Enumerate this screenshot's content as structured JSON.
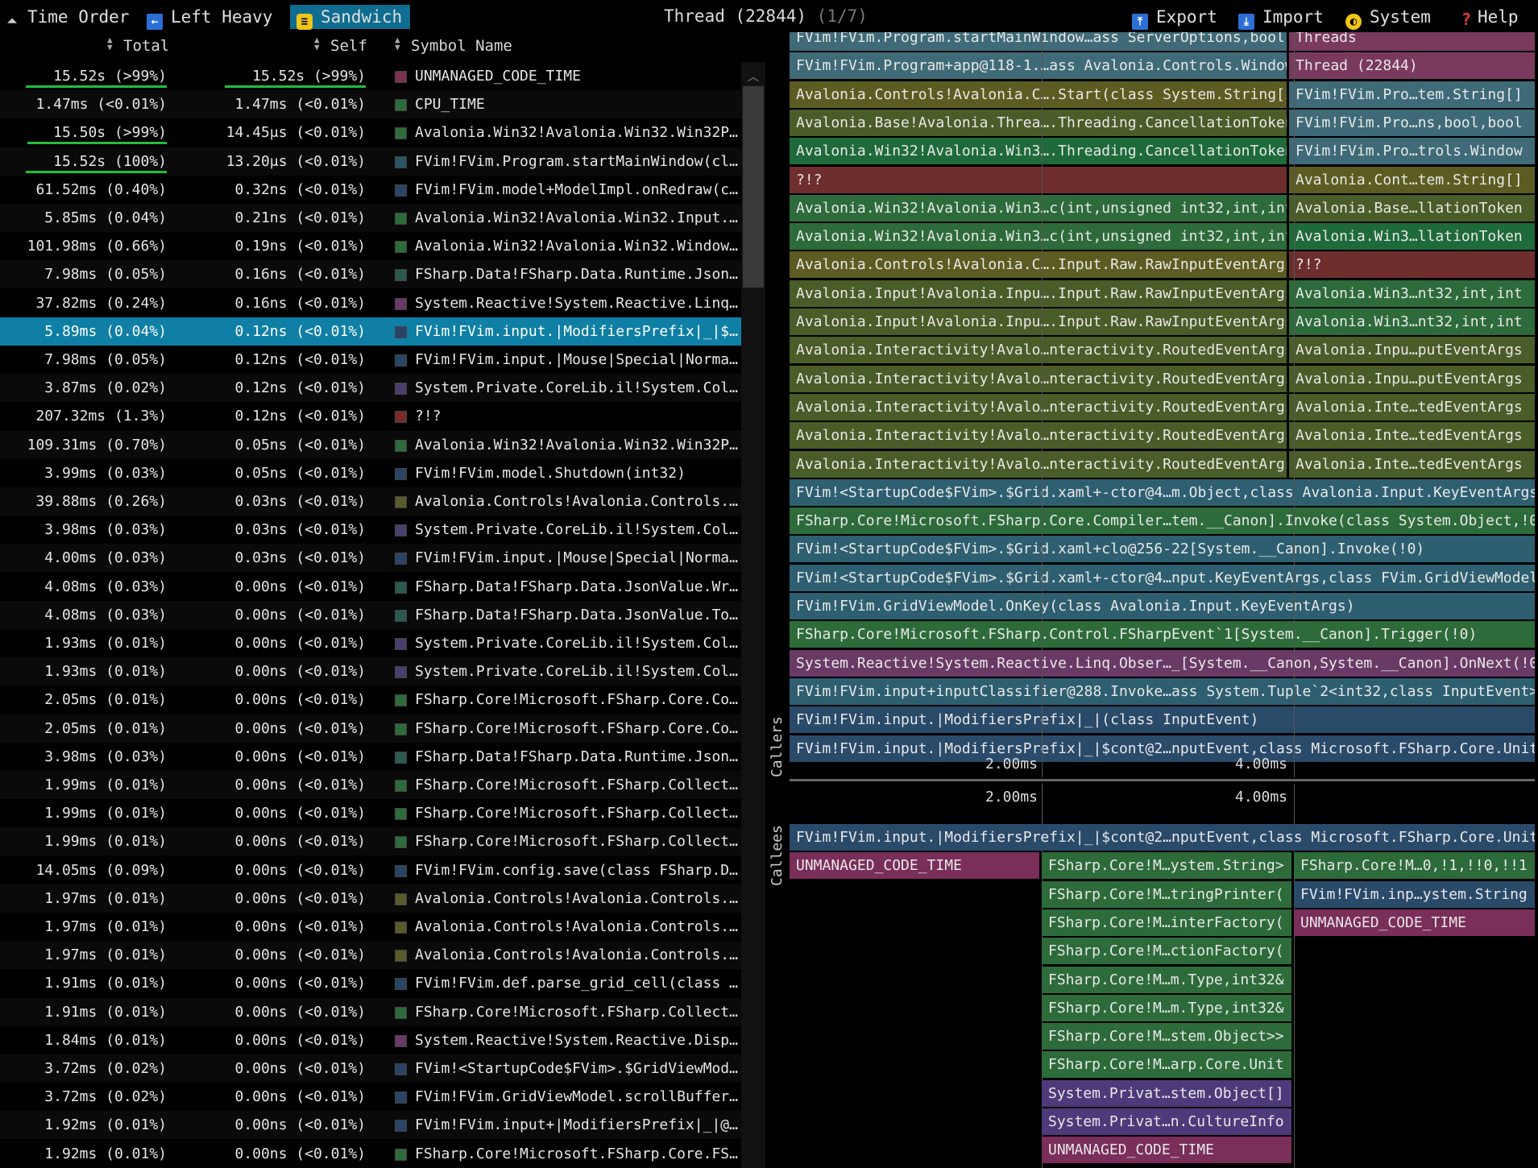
{
  "toolbar": {
    "time_order": "Time Order",
    "left_heavy": "Left Heavy",
    "sandwich": "Sandwich",
    "thread_title": "Thread (22844)",
    "thread_index": "(1/7)",
    "export": "Export",
    "import": "Import",
    "system": "System",
    "help": "Help"
  },
  "table": {
    "headers": {
      "total": "Total",
      "self": "Self",
      "symbol": "Symbol Name"
    },
    "rows": [
      {
        "total": "15.52s (>99%)",
        "self": "15.52s (>99%)",
        "name": "UNMANAGED_CODE_TIME",
        "color": "#7a3050",
        "tbar": 1.0,
        "sbar": 1.0
      },
      {
        "total": "1.47ms (<0.01%)",
        "self": "1.47ms (<0.01%)",
        "name": "CPU_TIME",
        "color": "#2d6b3a",
        "tbar": 0,
        "sbar": 0
      },
      {
        "total": "15.50s (>99%)",
        "self": "14.45μs (<0.01%)",
        "name": "Avalonia.Win32!Avalonia.Win32.Win32Pl…",
        "color": "#2d6b3a",
        "tbar": 0.99,
        "sbar": 0
      },
      {
        "total": "15.52s (100%)",
        "self": "13.20μs (<0.01%)",
        "name": "FVim!FVim.Program.startMainWindow(cla…",
        "color": "#2a5566",
        "tbar": 1.0,
        "sbar": 0
      },
      {
        "total": "61.52ms (0.40%)",
        "self": "0.32ns (<0.01%)",
        "name": "FVim!FVim.model+ModelImpl.onRedraw(cl…",
        "color": "#2a4466",
        "tbar": 0,
        "sbar": 0
      },
      {
        "total": "5.85ms (0.04%)",
        "self": "0.21ns (<0.01%)",
        "name": "Avalonia.Win32!Avalonia.Win32.Input.K…",
        "color": "#2d6b3a",
        "tbar": 0,
        "sbar": 0
      },
      {
        "total": "101.98ms (0.66%)",
        "self": "0.19ns (<0.01%)",
        "name": "Avalonia.Win32!Avalonia.Win32.WindowI…",
        "color": "#2d6b3a",
        "tbar": 0,
        "sbar": 0
      },
      {
        "total": "7.98ms (0.05%)",
        "self": "0.16ns (<0.01%)",
        "name": "FSharp.Data!FSharp.Data.Runtime.JsonR…",
        "color": "#2a5a4e",
        "tbar": 0,
        "sbar": 0
      },
      {
        "total": "37.82ms (0.24%)",
        "self": "0.16ns (<0.01%)",
        "name": "System.Reactive!System.Reactive.Linq.…",
        "color": "#6a3a66",
        "tbar": 0,
        "sbar": 0
      },
      {
        "total": "5.89ms (0.04%)",
        "self": "0.12ns (<0.01%)",
        "name": "FVim!FVim.input.|ModifiersPrefix|_|$c…",
        "color": "#2a4466",
        "tbar": 0,
        "sbar": 0
      },
      {
        "total": "7.98ms (0.05%)",
        "self": "0.12ns (<0.01%)",
        "name": "FVim!FVim.input.|Mouse|Special|Normal…",
        "color": "#2a4466",
        "tbar": 0,
        "sbar": 0
      },
      {
        "total": "3.87ms (0.02%)",
        "self": "0.12ns (<0.01%)",
        "name": "System.Private.CoreLib.il!System.Coll…",
        "color": "#4a3e6e",
        "tbar": 0,
        "sbar": 0
      },
      {
        "total": "207.32ms (1.3%)",
        "self": "0.12ns (<0.01%)",
        "name": "?!?",
        "color": "#7a2a2a",
        "tbar": 0,
        "sbar": 0
      },
      {
        "total": "109.31ms (0.70%)",
        "self": "0.05ns (<0.01%)",
        "name": "Avalonia.Win32!Avalonia.Win32.Win32Pl…",
        "color": "#2d6b3a",
        "tbar": 0,
        "sbar": 0
      },
      {
        "total": "3.99ms (0.03%)",
        "self": "0.05ns (<0.01%)",
        "name": "FVim!FVim.model.Shutdown(int32)",
        "color": "#2a4466",
        "tbar": 0,
        "sbar": 0
      },
      {
        "total": "39.88ms (0.26%)",
        "self": "0.03ns (<0.01%)",
        "name": "Avalonia.Controls!Avalonia.Controls.T…",
        "color": "#5a5a2a",
        "tbar": 0,
        "sbar": 0
      },
      {
        "total": "3.98ms (0.03%)",
        "self": "0.03ns (<0.01%)",
        "name": "System.Private.CoreLib.il!System.Coll…",
        "color": "#4a3e6e",
        "tbar": 0,
        "sbar": 0
      },
      {
        "total": "4.00ms (0.03%)",
        "self": "0.03ns (<0.01%)",
        "name": "FVim!FVim.input.|Mouse|Special|Normal…",
        "color": "#2a4466",
        "tbar": 0,
        "sbar": 0
      },
      {
        "total": "4.08ms (0.03%)",
        "self": "0.00ns (<0.01%)",
        "name": "FSharp.Data!FSharp.Data.JsonValue.Wri…",
        "color": "#2a5a4e",
        "tbar": 0,
        "sbar": 0
      },
      {
        "total": "4.08ms (0.03%)",
        "self": "0.00ns (<0.01%)",
        "name": "FSharp.Data!FSharp.Data.JsonValue.ToS…",
        "color": "#2a5a4e",
        "tbar": 0,
        "sbar": 0
      },
      {
        "total": "1.93ms (0.01%)",
        "self": "0.00ns (<0.01%)",
        "name": "System.Private.CoreLib.il!System.Coll…",
        "color": "#4a3e6e",
        "tbar": 0,
        "sbar": 0
      },
      {
        "total": "1.93ms (0.01%)",
        "self": "0.00ns (<0.01%)",
        "name": "System.Private.CoreLib.il!System.Coll…",
        "color": "#4a3e6e",
        "tbar": 0,
        "sbar": 0
      },
      {
        "total": "2.05ms (0.01%)",
        "self": "0.00ns (<0.01%)",
        "name": "FSharp.Core!Microsoft.FSharp.Core.Com…",
        "color": "#2d6b3a",
        "tbar": 0,
        "sbar": 0
      },
      {
        "total": "2.05ms (0.01%)",
        "self": "0.00ns (<0.01%)",
        "name": "FSharp.Core!Microsoft.FSharp.Core.Com…",
        "color": "#2d6b3a",
        "tbar": 0,
        "sbar": 0
      },
      {
        "total": "3.98ms (0.03%)",
        "self": "0.00ns (<0.01%)",
        "name": "FSharp.Data!FSharp.Data.Runtime.JsonR…",
        "color": "#2a5a4e",
        "tbar": 0,
        "sbar": 0
      },
      {
        "total": "1.99ms (0.01%)",
        "self": "0.00ns (<0.01%)",
        "name": "FSharp.Core!Microsoft.FSharp.Collecti…",
        "color": "#2d6b3a",
        "tbar": 0,
        "sbar": 0
      },
      {
        "total": "1.99ms (0.01%)",
        "self": "0.00ns (<0.01%)",
        "name": "FSharp.Core!Microsoft.FSharp.Collecti…",
        "color": "#2d6b3a",
        "tbar": 0,
        "sbar": 0
      },
      {
        "total": "1.99ms (0.01%)",
        "self": "0.00ns (<0.01%)",
        "name": "FSharp.Core!Microsoft.FSharp.Collecti…",
        "color": "#2d6b3a",
        "tbar": 0,
        "sbar": 0
      },
      {
        "total": "14.05ms (0.09%)",
        "self": "0.00ns (<0.01%)",
        "name": "FVim!FVim.config.save(class FSharp.Da…",
        "color": "#2a4466",
        "tbar": 0,
        "sbar": 0
      },
      {
        "total": "1.97ms (0.01%)",
        "self": "0.00ns (<0.01%)",
        "name": "Avalonia.Controls!Avalonia.Controls.W…",
        "color": "#5a5a2a",
        "tbar": 0,
        "sbar": 0
      },
      {
        "total": "1.97ms (0.01%)",
        "self": "0.00ns (<0.01%)",
        "name": "Avalonia.Controls!Avalonia.Controls.W…",
        "color": "#5a5a2a",
        "tbar": 0,
        "sbar": 0
      },
      {
        "total": "1.97ms (0.01%)",
        "self": "0.00ns (<0.01%)",
        "name": "Avalonia.Controls!Avalonia.Controls.A…",
        "color": "#5a5a2a",
        "tbar": 0,
        "sbar": 0
      },
      {
        "total": "1.91ms (0.01%)",
        "self": "0.00ns (<0.01%)",
        "name": "FVim!FVim.def.parse_grid_cell(class S…",
        "color": "#2a4466",
        "tbar": 0,
        "sbar": 0
      },
      {
        "total": "1.91ms (0.01%)",
        "self": "0.00ns (<0.01%)",
        "name": "FSharp.Core!Microsoft.FSharp.Collecti…",
        "color": "#2d6b3a",
        "tbar": 0,
        "sbar": 0
      },
      {
        "total": "1.84ms (0.01%)",
        "self": "0.00ns (<0.01%)",
        "name": "System.Reactive!System.Reactive.Dispo…",
        "color": "#6a3a66",
        "tbar": 0,
        "sbar": 0
      },
      {
        "total": "3.72ms (0.02%)",
        "self": "0.00ns (<0.01%)",
        "name": "FVim!<StartupCode$FVim>.$GridViewMode…",
        "color": "#2a4466",
        "tbar": 0,
        "sbar": 0
      },
      {
        "total": "3.72ms (0.02%)",
        "self": "0.00ns (<0.01%)",
        "name": "FVim!FVim.GridViewModel.scrollBuffer(…",
        "color": "#2a4466",
        "tbar": 0,
        "sbar": 0
      },
      {
        "total": "1.92ms (0.01%)",
        "self": "0.00ns (<0.01%)",
        "name": "FVim!FVim.input+|ModifiersPrefix|_|@2…",
        "color": "#2a4466",
        "tbar": 0,
        "sbar": 0
      },
      {
        "total": "1.92ms (0.01%)",
        "self": "0.00ns (<0.01%)",
        "name": "FSharp.Core!Microsoft.FSharp.Core.FSh…",
        "color": "#2d6b3a",
        "tbar": 0,
        "sbar": 0
      }
    ],
    "selected_index": 9
  },
  "callers": {
    "label": "Callers",
    "ticks": [
      "2.00ms",
      "4.00ms"
    ],
    "frames": [
      {
        "text": "FVim!FVim.Program.startMainWindow…ass ServerOptions,bool,bool",
        "col": 0,
        "color": "#3f6b78"
      },
      {
        "text": "Threads",
        "col": 1,
        "color": "#7a3a5e"
      },
      {
        "text": "FVim!FVim.Program+app@118-1.…ass Avalonia.Controls.Window",
        "col": 0,
        "color": "#3f6b78"
      },
      {
        "text": "Thread (22844)",
        "col": 1,
        "color": "#7a3a5e"
      },
      {
        "text": "Avalonia.Controls!Avalonia.C….Start(class System.String[]",
        "col": 0,
        "color": "#5c5c22"
      },
      {
        "text": "FVim!FVim.Pro…tem.String[]",
        "col": 1,
        "color": "#3f6b78"
      },
      {
        "text": "Avalonia.Base!Avalonia.Threa….Threading.CancellationToken",
        "col": 0,
        "color": "#4a5c28"
      },
      {
        "text": "FVim!FVim.Pro…ns,bool,bool",
        "col": 1,
        "color": "#3f6b78"
      },
      {
        "text": "Avalonia.Win32!Avalonia.Win3….Threading.CancellationToken",
        "col": 0,
        "color": "#1f6a3a"
      },
      {
        "text": "FVim!FVim.Pro…trols.Window",
        "col": 1,
        "color": "#3f6b78"
      },
      {
        "text": "?!?",
        "col": 0,
        "color": "#6e2e2e"
      },
      {
        "text": "Avalonia.Cont…tem.String[]",
        "col": 1,
        "color": "#5c5c22"
      },
      {
        "text": "Avalonia.Win32!Avalonia.Win3…c(int,unsigned int32,int,int",
        "col": 0,
        "color": "#2d6b3a"
      },
      {
        "text": "Avalonia.Base…llationToken",
        "col": 1,
        "color": "#4a5c28"
      },
      {
        "text": "Avalonia.Win32!Avalonia.Win3…c(int,unsigned int32,int,int",
        "col": 0,
        "color": "#2d6b3a"
      },
      {
        "text": "Avalonia.Win3…llationToken",
        "col": 1,
        "color": "#1f6a3a"
      },
      {
        "text": "Avalonia.Controls!Avalonia.C….Input.Raw.RawInputEventArgs",
        "col": 0,
        "color": "#5c5c22"
      },
      {
        "text": "?!?",
        "col": 1,
        "color": "#6e2e2e"
      },
      {
        "text": "Avalonia.Input!Avalonia.Inpu….Input.Raw.RawInputEventArgs",
        "col": 0,
        "color": "#4a5c28"
      },
      {
        "text": "Avalonia.Win3…nt32,int,int",
        "col": 1,
        "color": "#2d6b3a"
      },
      {
        "text": "Avalonia.Input!Avalonia.Inpu….Input.Raw.RawInputEventArgs",
        "col": 0,
        "color": "#4a5c28"
      },
      {
        "text": "Avalonia.Win3…nt32,int,int",
        "col": 1,
        "color": "#2d6b3a"
      },
      {
        "text": "Avalonia.Interactivity!Avalo…nteractivity.RoutedEventArgs",
        "col": 0,
        "color": "#4a5c28"
      },
      {
        "text": "Avalonia.Inpu…putEventArgs",
        "col": 1,
        "color": "#4a5c28"
      },
      {
        "text": "Avalonia.Interactivity!Avalo…nteractivity.RoutedEventArgs",
        "col": 0,
        "color": "#4a5c28"
      },
      {
        "text": "Avalonia.Inpu…putEventArgs",
        "col": 1,
        "color": "#4a5c28"
      },
      {
        "text": "Avalonia.Interactivity!Avalo…nteractivity.RoutedEventArgs",
        "col": 0,
        "color": "#4a5c28"
      },
      {
        "text": "Avalonia.Inte…tedEventArgs",
        "col": 1,
        "color": "#4a5c28"
      },
      {
        "text": "Avalonia.Interactivity!Avalo…nteractivity.RoutedEventArgs",
        "col": 0,
        "color": "#4a5c28"
      },
      {
        "text": "Avalonia.Inte…tedEventArgs",
        "col": 1,
        "color": "#4a5c28"
      },
      {
        "text": "Avalonia.Interactivity!Avalo…nteractivity.RoutedEventArgs",
        "col": 0,
        "color": "#4a5c28"
      },
      {
        "text": "Avalonia.Inte…tedEventArgs",
        "col": 1,
        "color": "#4a5c28"
      },
      {
        "text": "FVim!<StartupCode$FVim>.$Grid.xaml+-ctor@4…m.Object,class Avalonia.Input.KeyEventArgs",
        "col": 2,
        "color": "#2e5f70"
      },
      {
        "text": "FSharp.Core!Microsoft.FSharp.Core.Compiler…tem.__Canon].Invoke(class System.Object,!0",
        "col": 2,
        "color": "#2d6b3a"
      },
      {
        "text": "FVim!<StartupCode$FVim>.$Grid.xaml+clo@256-22[System.__Canon].Invoke(!0)",
        "col": 2,
        "color": "#2e5f70"
      },
      {
        "text": "FVim!<StartupCode$FVim>.$Grid.xaml+-ctor@4…nput.KeyEventArgs,class FVim.GridViewModel",
        "col": 2,
        "color": "#2e5f70"
      },
      {
        "text": "FVim!FVim.GridViewModel.OnKey(class Avalonia.Input.KeyEventArgs)",
        "col": 2,
        "color": "#2e5f70"
      },
      {
        "text": "FSharp.Core!Microsoft.FSharp.Control.FSharpEvent`1[System.__Canon].Trigger(!0)",
        "col": 2,
        "color": "#2d6b3a"
      },
      {
        "text": "System.Reactive!System.Reactive.Linq.Obser…_[System.__Canon,System.__Canon].OnNext(!0",
        "col": 2,
        "color": "#6a3a66"
      },
      {
        "text": "FVim!FVim.input+inputClassifier@288.Invoke…ass System.Tuple`2<int32,class InputEvent>",
        "col": 2,
        "color": "#2e5f70"
      },
      {
        "text": "FVim!FVim.input.|ModifiersPrefix|_|(class InputEvent)",
        "col": 2,
        "color": "#2a4a6a"
      },
      {
        "text": "FVim!FVim.input.|ModifiersPrefix|_|$cont@2…nputEvent,class Microsoft.FSharp.Core.Unit",
        "col": 2,
        "color": "#2a4a6a"
      }
    ]
  },
  "callees": {
    "label": "Callees",
    "ticks": [
      "2.00ms",
      "4.00ms"
    ],
    "frames": [
      {
        "text": "FVim!FVim.input.|ModifiersPrefix|_|$cont@2…nputEvent,class Microsoft.FSharp.Core.Unit",
        "col": "full",
        "color": "#2a4a6a"
      },
      {
        "text": "UNMANAGED_CODE_TIME",
        "col": "a",
        "color": "#7a2e5a"
      },
      {
        "text": "FSharp.Core!M…ystem.String>",
        "col": "b",
        "color": "#2d6b3a"
      },
      {
        "text": "FSharp.Core!M…0,!1,!!0,!!1",
        "col": "c",
        "color": "#2d6b3a"
      },
      {
        "text": "FSharp.Core!M…tringPrinter(",
        "col": "b",
        "color": "#2d6b3a"
      },
      {
        "text": "FVim!FVim.inp…ystem.String",
        "col": "c",
        "color": "#2a4a6a"
      },
      {
        "text": "FSharp.Core!M…interFactory(",
        "col": "b",
        "color": "#2d6b3a"
      },
      {
        "text": "UNMANAGED_CODE_TIME",
        "col": "c",
        "color": "#7a2e5a"
      },
      {
        "text": "FSharp.Core!M…ctionFactory(",
        "col": "b",
        "color": "#2d6b3a"
      },
      {
        "text": "FSharp.Core!M…m.Type,int32&",
        "col": "b",
        "color": "#2d6b3a"
      },
      {
        "text": "FSharp.Core!M…m.Type,int32&",
        "col": "b",
        "color": "#2d6b3a"
      },
      {
        "text": "FSharp.Core!M…stem.Object>>",
        "col": "b",
        "color": "#2d6b3a"
      },
      {
        "text": "FSharp.Core!M…arp.Core.Unit",
        "col": "b",
        "color": "#2d6b3a"
      },
      {
        "text": "System.Privat…stem.Object[]",
        "col": "b",
        "color": "#4e3a7a"
      },
      {
        "text": "System.Privat…n.CultureInfo",
        "col": "b",
        "color": "#4e3a7a"
      },
      {
        "text": "UNMANAGED_CODE_TIME",
        "col": "b",
        "color": "#7a2e5a"
      }
    ]
  }
}
